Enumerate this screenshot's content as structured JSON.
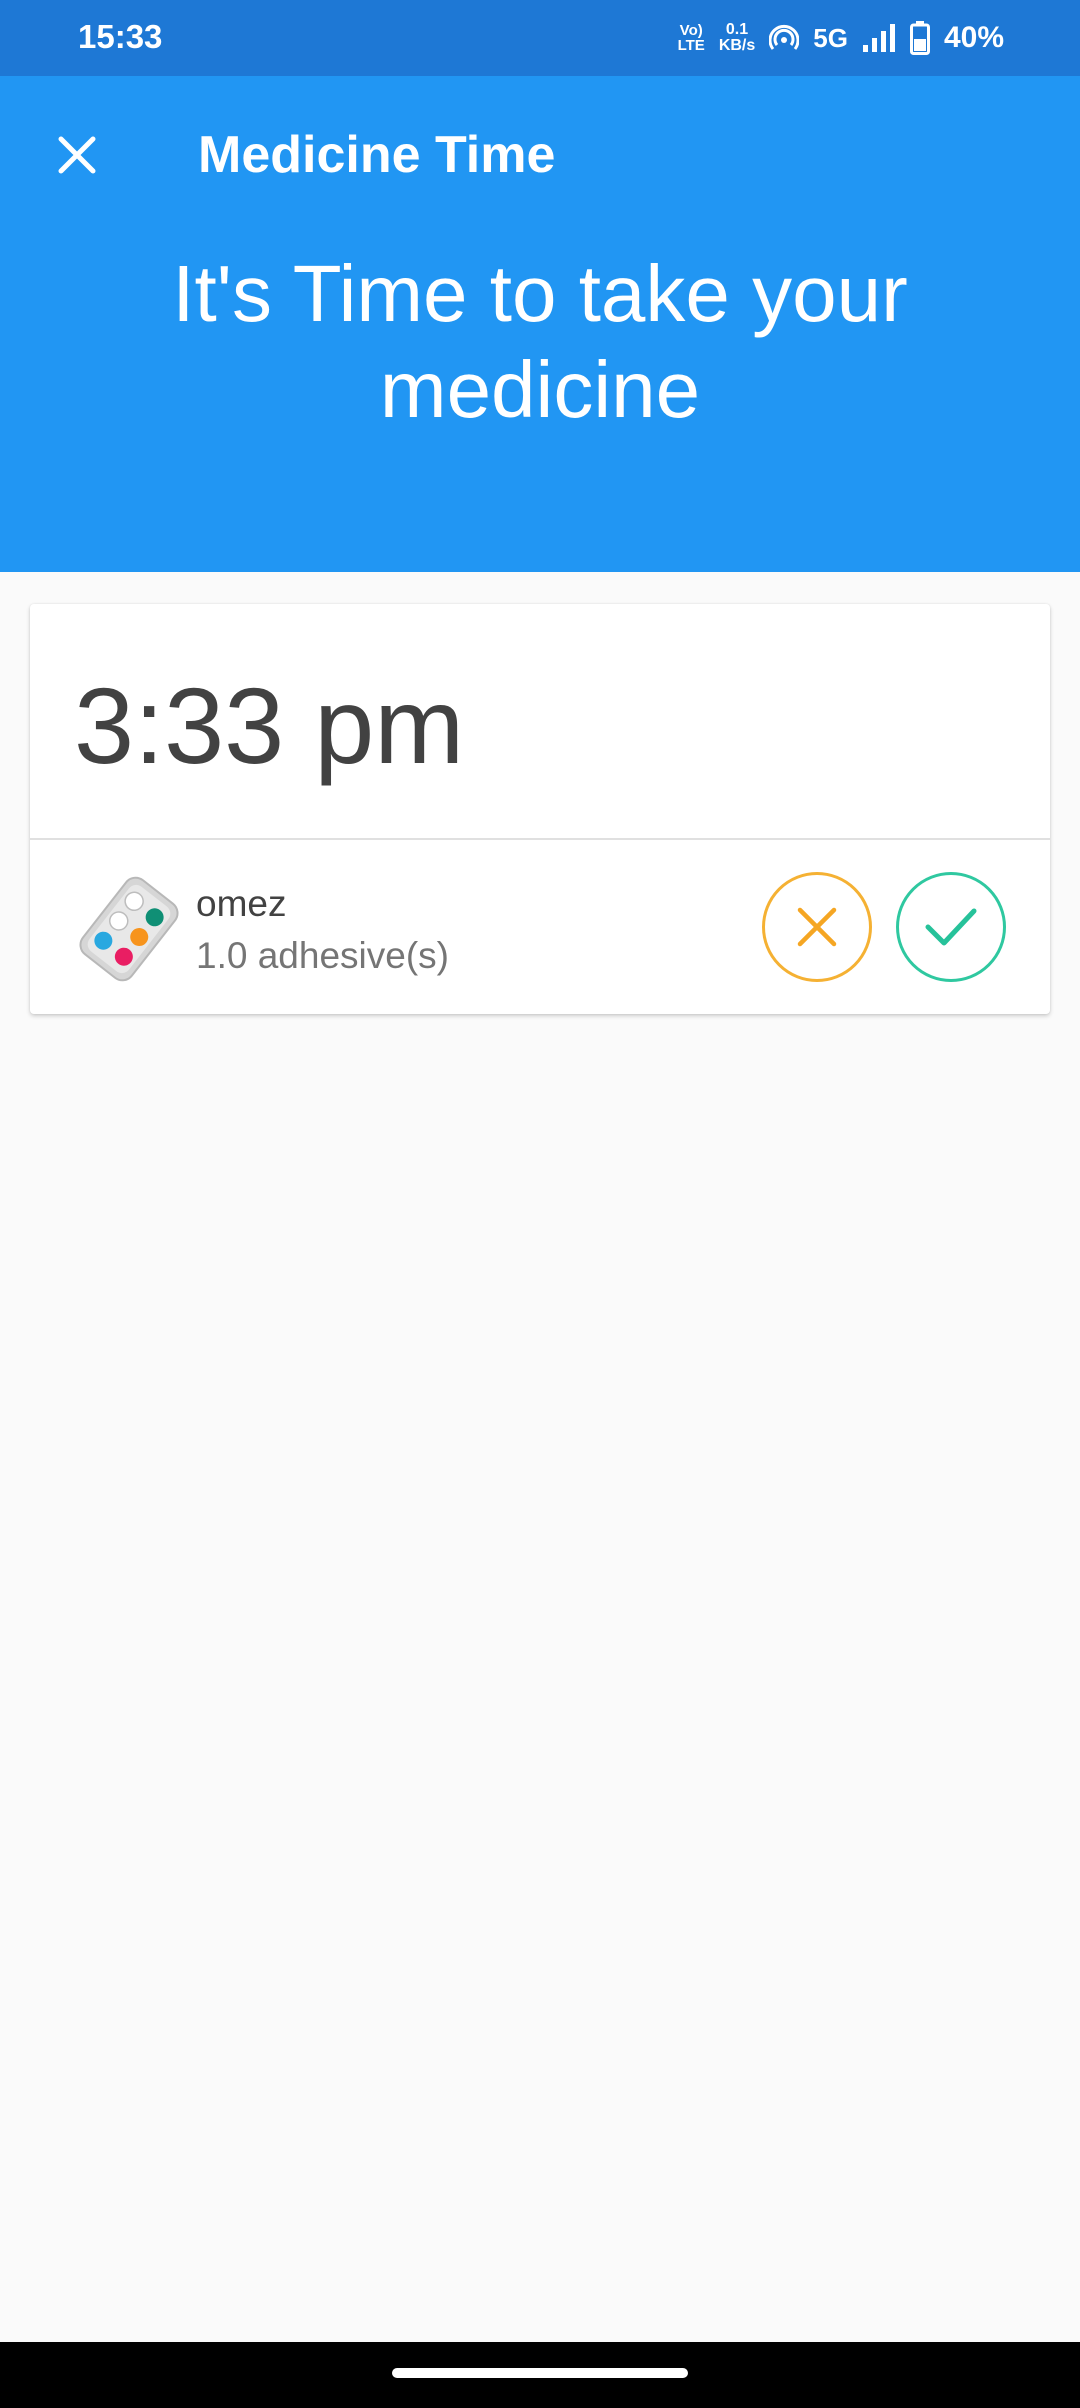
{
  "status_bar": {
    "time": "15:33",
    "volte_top": "Vo)",
    "volte_bottom": "LTE",
    "net_speed_value": "0.1",
    "net_speed_unit": "KB/s",
    "network_type": "5G",
    "battery": "40%"
  },
  "header": {
    "title": "Medicine Time",
    "headline": "It's Time to take your medicine",
    "background_color": "#2196f3"
  },
  "reminder_card": {
    "time": "3:33 pm",
    "medicine": {
      "name": "omez",
      "dose": "1.0 adhesive(s)",
      "icon": "pill-pack-icon"
    },
    "actions": {
      "skip_icon": "close-icon",
      "skip_color": "#f5b133",
      "take_icon": "check-icon",
      "take_color": "#2fc8a0"
    }
  }
}
